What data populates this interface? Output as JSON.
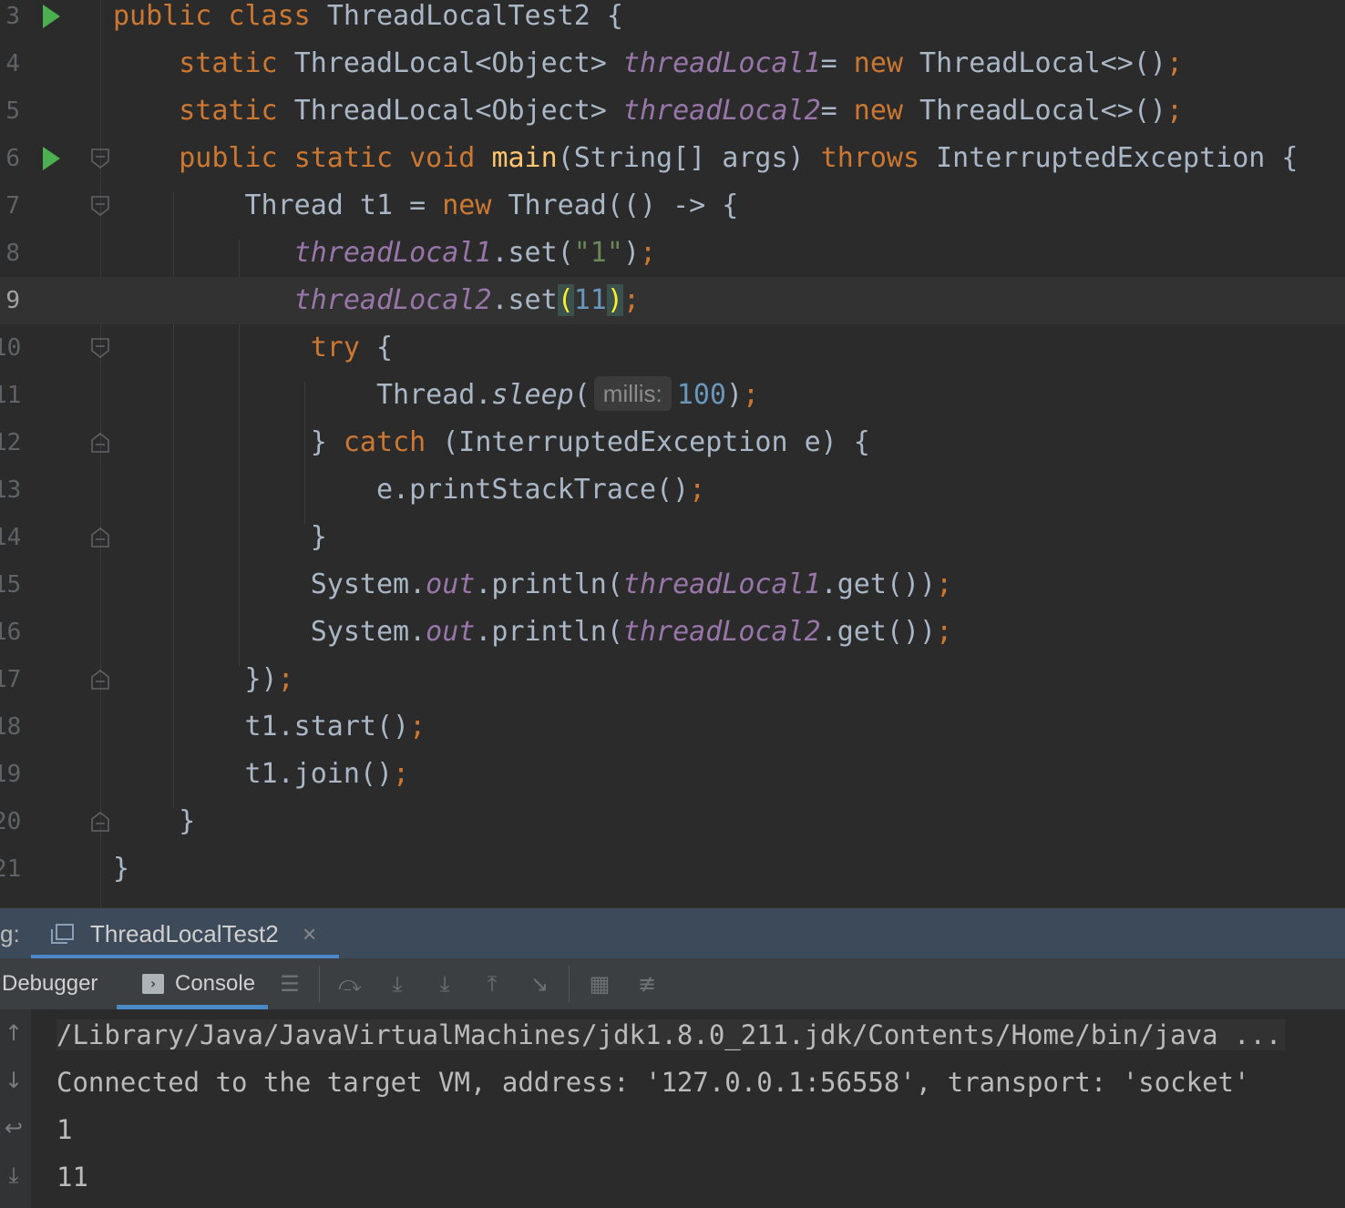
{
  "editor": {
    "current_line": "9",
    "lines": [
      {
        "num": "3",
        "parts": [
          [
            "kw",
            "public "
          ],
          [
            "kw",
            "class "
          ],
          [
            "",
            "ThreadLocalTest2 {"
          ]
        ]
      },
      {
        "num": "4",
        "parts": [
          [
            "",
            "    "
          ],
          [
            "kw",
            "static "
          ],
          [
            "",
            "ThreadLocal<Object> "
          ],
          [
            "fld",
            "threadLocal1"
          ],
          [
            "",
            "= "
          ],
          [
            "kw",
            "new "
          ],
          [
            "",
            "ThreadLocal<>()"
          ],
          [
            "semi",
            ";"
          ]
        ]
      },
      {
        "num": "5",
        "parts": [
          [
            "",
            "    "
          ],
          [
            "kw",
            "static "
          ],
          [
            "",
            "ThreadLocal<Object> "
          ],
          [
            "fld",
            "threadLocal2"
          ],
          [
            "",
            "= "
          ],
          [
            "kw",
            "new "
          ],
          [
            "",
            "ThreadLocal<>()"
          ],
          [
            "semi",
            ";"
          ]
        ]
      },
      {
        "num": "6",
        "parts": [
          [
            "",
            "    "
          ],
          [
            "kw",
            "public "
          ],
          [
            "kw",
            "static "
          ],
          [
            "kw",
            "void "
          ],
          [
            "fn",
            "main"
          ],
          [
            "",
            "(String[] args) "
          ],
          [
            "kw",
            "throws "
          ],
          [
            "",
            "InterruptedException {"
          ]
        ]
      },
      {
        "num": "7",
        "parts": [
          [
            "",
            "        Thread t1 = "
          ],
          [
            "kw",
            "new "
          ],
          [
            "",
            "Thread(() -> {"
          ]
        ]
      },
      {
        "num": "8",
        "parts": [
          [
            "",
            "           "
          ],
          [
            "fld",
            "threadLocal1"
          ],
          [
            "",
            ".set("
          ],
          [
            "str",
            "\"1\""
          ],
          [
            "",
            ")"
          ],
          [
            "semi",
            ";"
          ]
        ]
      },
      {
        "num": "9",
        "parts": [
          [
            "",
            "           "
          ],
          [
            "fld",
            "threadLocal2"
          ],
          [
            "",
            ".set"
          ],
          [
            "brace-hl",
            "("
          ],
          [
            "num",
            "11"
          ],
          [
            "brace-hl",
            ")"
          ],
          [
            "semi",
            ";"
          ]
        ]
      },
      {
        "num": "10",
        "parts": [
          [
            "",
            "            "
          ],
          [
            "kw",
            "try "
          ],
          [
            "",
            "{"
          ]
        ]
      },
      {
        "num": "11",
        "parts": [
          [
            "",
            "                Thread."
          ],
          [
            "st-m",
            "sleep"
          ],
          [
            "",
            "("
          ],
          [
            "hint",
            "millis:"
          ],
          [
            "num",
            "100"
          ],
          [
            "",
            ")"
          ],
          [
            "semi",
            ";"
          ]
        ]
      },
      {
        "num": "12",
        "parts": [
          [
            "",
            "            } "
          ],
          [
            "kw",
            "catch "
          ],
          [
            "",
            "(InterruptedException e) {"
          ]
        ]
      },
      {
        "num": "13",
        "parts": [
          [
            "",
            "                e.printStackTrace()"
          ],
          [
            "semi",
            ";"
          ]
        ]
      },
      {
        "num": "14",
        "parts": [
          [
            "",
            "            }"
          ]
        ]
      },
      {
        "num": "15",
        "parts": [
          [
            "",
            "            System."
          ],
          [
            "st-fld",
            "out"
          ],
          [
            "",
            ".println("
          ],
          [
            "fld",
            "threadLocal1"
          ],
          [
            "",
            ".get())"
          ],
          [
            "semi",
            ";"
          ]
        ]
      },
      {
        "num": "16",
        "parts": [
          [
            "",
            "            System."
          ],
          [
            "st-fld",
            "out"
          ],
          [
            "",
            ".println("
          ],
          [
            "fld",
            "threadLocal2"
          ],
          [
            "",
            ".get())"
          ],
          [
            "semi",
            ";"
          ]
        ]
      },
      {
        "num": "17",
        "parts": [
          [
            "",
            "        })"
          ],
          [
            "semi",
            ";"
          ]
        ]
      },
      {
        "num": "18",
        "parts": [
          [
            "",
            "        t1.start()"
          ],
          [
            "semi",
            ";"
          ]
        ]
      },
      {
        "num": "19",
        "parts": [
          [
            "",
            "        t1.join()"
          ],
          [
            "semi",
            ";"
          ]
        ]
      },
      {
        "num": "20",
        "parts": [
          [
            "",
            "    }"
          ]
        ]
      },
      {
        "num": "21",
        "parts": [
          [
            "",
            "}"
          ]
        ]
      }
    ]
  },
  "debug_panel": {
    "label": "g:",
    "session_tab": "ThreadLocalTest2",
    "close_glyph": "×",
    "tabs": {
      "debugger": "Debugger",
      "console": "Console"
    }
  },
  "console": {
    "lines": [
      "/Library/Java/JavaVirtualMachines/jdk1.8.0_211.jdk/Contents/Home/bin/java ...",
      "Connected to the target VM, address: '127.0.0.1:56558', transport: 'socket'",
      "1",
      "11"
    ]
  },
  "icons": {
    "run": "run-gutter-icon",
    "fold": "fold-marker-icon",
    "toolbar": [
      "layout-icon",
      "step-over-icon",
      "step-into-icon",
      "force-step-into-icon",
      "step-out-icon",
      "run-to-cursor-icon",
      "evaluate-icon",
      "trace-icon"
    ]
  },
  "colors": {
    "keyword": "#cc7832",
    "field": "#9876aa",
    "method": "#ffc66d",
    "number": "#6897bb",
    "string": "#6a8759",
    "run": "#4caf50",
    "accent": "#4a88c7"
  }
}
